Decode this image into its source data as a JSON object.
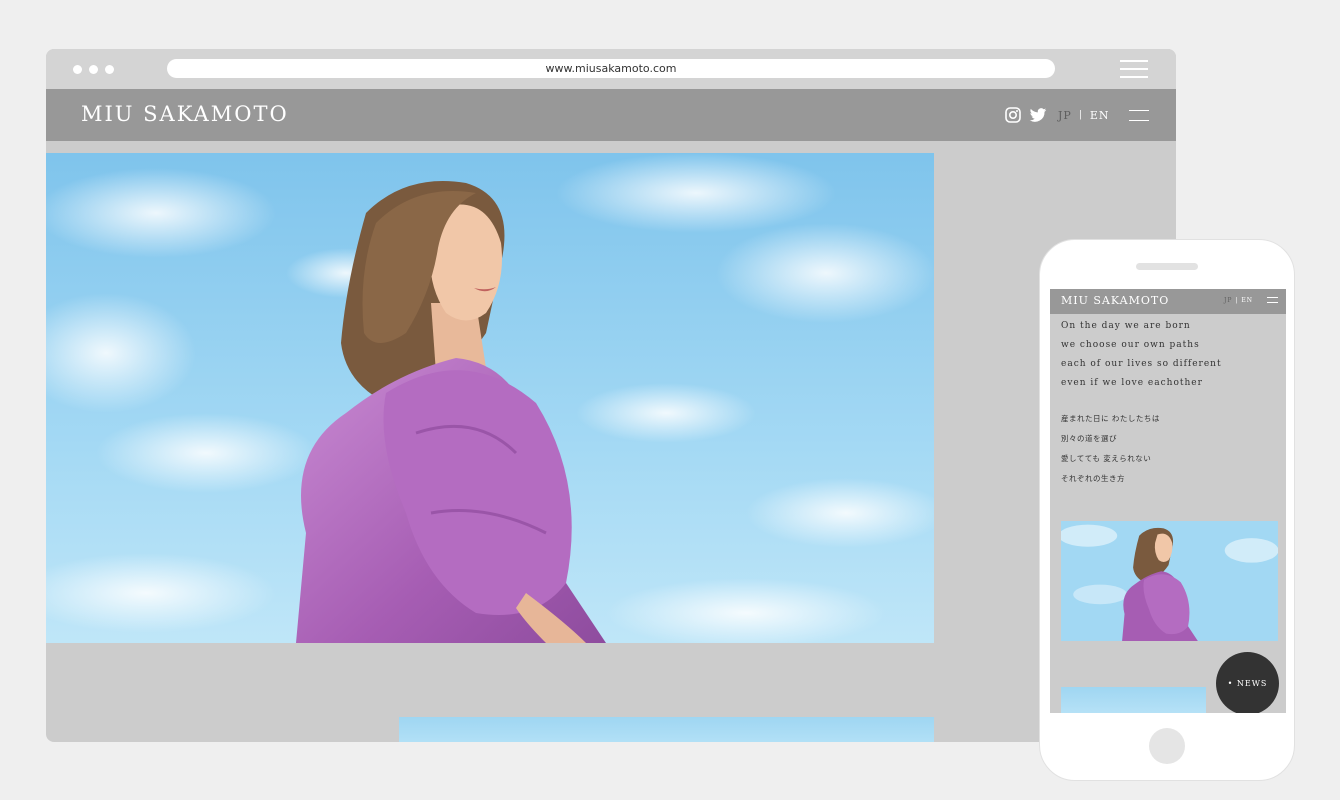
{
  "browser": {
    "url": "www.miusakamoto.com"
  },
  "site": {
    "logo": "MIU SAKAMOTO",
    "lang_jp": "JP",
    "lang_separator": "|",
    "lang_en": "EN"
  },
  "mobile": {
    "logo": "MIU SAKAMOTO",
    "lang_jp": "JP",
    "lang_separator": "|",
    "lang_en": "EN",
    "poem_en": [
      "On the day we are born",
      "we choose our own paths",
      "each of our lives so different",
      "even if we love eachother"
    ],
    "poem_jp": [
      "産まれた日に わたしたちは",
      "別々の道を選び",
      "愛してても 変えられない",
      "それぞれの生き方"
    ],
    "news_button": "• NEWS"
  },
  "colors": {
    "page_bg": "#efefef",
    "browser_bg": "#cccccc",
    "header_bg": "#989898",
    "news_bg": "#333333",
    "sky": "#8fcdef",
    "dress": "#b56fc0"
  },
  "icons": [
    "instagram-icon",
    "twitter-icon",
    "menu-icon"
  ]
}
